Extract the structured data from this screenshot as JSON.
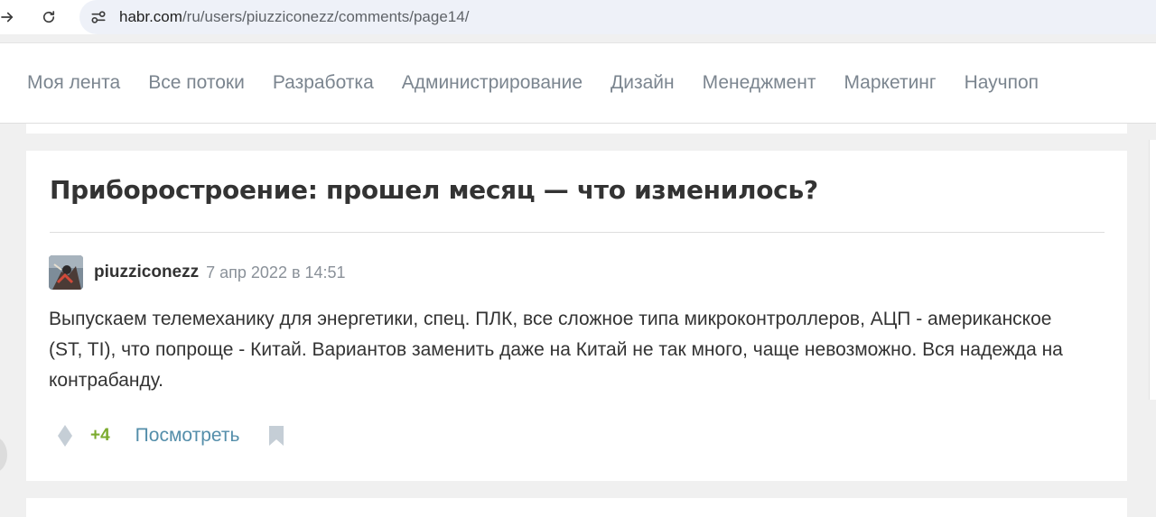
{
  "browser": {
    "url_host": "habr.com",
    "url_path": "/ru/users/piuzziconezz/comments/page14/"
  },
  "nav": {
    "items": [
      "Моя лента",
      "Все потоки",
      "Разработка",
      "Администрирование",
      "Дизайн",
      "Менеджмент",
      "Маркетинг",
      "Научпоп"
    ]
  },
  "comment": {
    "post_title": "Приборостроение: прошел месяц — что изменилось?",
    "author": "piuzziconezz",
    "timestamp": "7 апр 2022 в 14:51",
    "text": "Выпускаем телемеханику для энергетики, спец. ПЛК, все сложное типа микроконтроллеров, АЦП - американское (ST, TI), что попроще - Китай. Вариантов заменить даже на Китай не так много, чаще невозможно. Вся надежда на контрабанду.",
    "score": "+4",
    "view_label": "Посмотреть"
  },
  "colors": {
    "score": "#7bab2e",
    "link": "#548eaa",
    "nav_text": "#7b858f",
    "icon_gray": "#c5ced6"
  },
  "icons": {
    "back": "arrow-right-icon",
    "reload": "reload-icon",
    "site_info": "tune-icon",
    "vote": "vote-icon",
    "bookmark": "bookmark-icon"
  }
}
